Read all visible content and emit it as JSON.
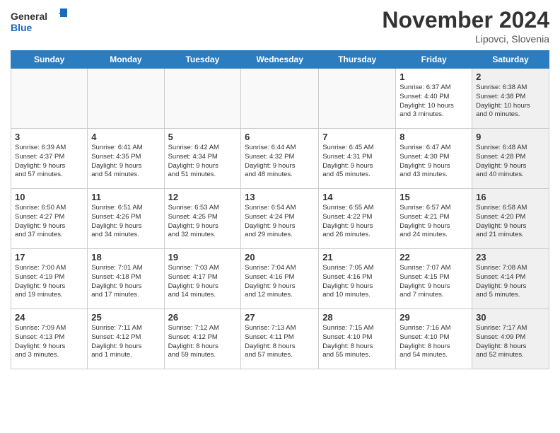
{
  "header": {
    "logo_line1": "General",
    "logo_line2": "Blue",
    "month_title": "November 2024",
    "location": "Lipovci, Slovenia"
  },
  "days_of_week": [
    "Sunday",
    "Monday",
    "Tuesday",
    "Wednesday",
    "Thursday",
    "Friday",
    "Saturday"
  ],
  "weeks": [
    [
      {
        "day": "",
        "info": "",
        "shaded": true
      },
      {
        "day": "",
        "info": "",
        "shaded": true
      },
      {
        "day": "",
        "info": "",
        "shaded": true
      },
      {
        "day": "",
        "info": "",
        "shaded": true
      },
      {
        "day": "",
        "info": "",
        "shaded": true
      },
      {
        "day": "1",
        "info": "Sunrise: 6:37 AM\nSunset: 4:40 PM\nDaylight: 10 hours\nand 3 minutes.",
        "shaded": false
      },
      {
        "day": "2",
        "info": "Sunrise: 6:38 AM\nSunset: 4:38 PM\nDaylight: 10 hours\nand 0 minutes.",
        "shaded": true
      }
    ],
    [
      {
        "day": "3",
        "info": "Sunrise: 6:39 AM\nSunset: 4:37 PM\nDaylight: 9 hours\nand 57 minutes.",
        "shaded": false
      },
      {
        "day": "4",
        "info": "Sunrise: 6:41 AM\nSunset: 4:35 PM\nDaylight: 9 hours\nand 54 minutes.",
        "shaded": false
      },
      {
        "day": "5",
        "info": "Sunrise: 6:42 AM\nSunset: 4:34 PM\nDaylight: 9 hours\nand 51 minutes.",
        "shaded": false
      },
      {
        "day": "6",
        "info": "Sunrise: 6:44 AM\nSunset: 4:32 PM\nDaylight: 9 hours\nand 48 minutes.",
        "shaded": false
      },
      {
        "day": "7",
        "info": "Sunrise: 6:45 AM\nSunset: 4:31 PM\nDaylight: 9 hours\nand 45 minutes.",
        "shaded": false
      },
      {
        "day": "8",
        "info": "Sunrise: 6:47 AM\nSunset: 4:30 PM\nDaylight: 9 hours\nand 43 minutes.",
        "shaded": false
      },
      {
        "day": "9",
        "info": "Sunrise: 6:48 AM\nSunset: 4:28 PM\nDaylight: 9 hours\nand 40 minutes.",
        "shaded": true
      }
    ],
    [
      {
        "day": "10",
        "info": "Sunrise: 6:50 AM\nSunset: 4:27 PM\nDaylight: 9 hours\nand 37 minutes.",
        "shaded": false
      },
      {
        "day": "11",
        "info": "Sunrise: 6:51 AM\nSunset: 4:26 PM\nDaylight: 9 hours\nand 34 minutes.",
        "shaded": false
      },
      {
        "day": "12",
        "info": "Sunrise: 6:53 AM\nSunset: 4:25 PM\nDaylight: 9 hours\nand 32 minutes.",
        "shaded": false
      },
      {
        "day": "13",
        "info": "Sunrise: 6:54 AM\nSunset: 4:24 PM\nDaylight: 9 hours\nand 29 minutes.",
        "shaded": false
      },
      {
        "day": "14",
        "info": "Sunrise: 6:55 AM\nSunset: 4:22 PM\nDaylight: 9 hours\nand 26 minutes.",
        "shaded": false
      },
      {
        "day": "15",
        "info": "Sunrise: 6:57 AM\nSunset: 4:21 PM\nDaylight: 9 hours\nand 24 minutes.",
        "shaded": false
      },
      {
        "day": "16",
        "info": "Sunrise: 6:58 AM\nSunset: 4:20 PM\nDaylight: 9 hours\nand 21 minutes.",
        "shaded": true
      }
    ],
    [
      {
        "day": "17",
        "info": "Sunrise: 7:00 AM\nSunset: 4:19 PM\nDaylight: 9 hours\nand 19 minutes.",
        "shaded": false
      },
      {
        "day": "18",
        "info": "Sunrise: 7:01 AM\nSunset: 4:18 PM\nDaylight: 9 hours\nand 17 minutes.",
        "shaded": false
      },
      {
        "day": "19",
        "info": "Sunrise: 7:03 AM\nSunset: 4:17 PM\nDaylight: 9 hours\nand 14 minutes.",
        "shaded": false
      },
      {
        "day": "20",
        "info": "Sunrise: 7:04 AM\nSunset: 4:16 PM\nDaylight: 9 hours\nand 12 minutes.",
        "shaded": false
      },
      {
        "day": "21",
        "info": "Sunrise: 7:05 AM\nSunset: 4:16 PM\nDaylight: 9 hours\nand 10 minutes.",
        "shaded": false
      },
      {
        "day": "22",
        "info": "Sunrise: 7:07 AM\nSunset: 4:15 PM\nDaylight: 9 hours\nand 7 minutes.",
        "shaded": false
      },
      {
        "day": "23",
        "info": "Sunrise: 7:08 AM\nSunset: 4:14 PM\nDaylight: 9 hours\nand 5 minutes.",
        "shaded": true
      }
    ],
    [
      {
        "day": "24",
        "info": "Sunrise: 7:09 AM\nSunset: 4:13 PM\nDaylight: 9 hours\nand 3 minutes.",
        "shaded": false
      },
      {
        "day": "25",
        "info": "Sunrise: 7:11 AM\nSunset: 4:12 PM\nDaylight: 9 hours\nand 1 minute.",
        "shaded": false
      },
      {
        "day": "26",
        "info": "Sunrise: 7:12 AM\nSunset: 4:12 PM\nDaylight: 8 hours\nand 59 minutes.",
        "shaded": false
      },
      {
        "day": "27",
        "info": "Sunrise: 7:13 AM\nSunset: 4:11 PM\nDaylight: 8 hours\nand 57 minutes.",
        "shaded": false
      },
      {
        "day": "28",
        "info": "Sunrise: 7:15 AM\nSunset: 4:10 PM\nDaylight: 8 hours\nand 55 minutes.",
        "shaded": false
      },
      {
        "day": "29",
        "info": "Sunrise: 7:16 AM\nSunset: 4:10 PM\nDaylight: 8 hours\nand 54 minutes.",
        "shaded": false
      },
      {
        "day": "30",
        "info": "Sunrise: 7:17 AM\nSunset: 4:09 PM\nDaylight: 8 hours\nand 52 minutes.",
        "shaded": true
      }
    ]
  ]
}
